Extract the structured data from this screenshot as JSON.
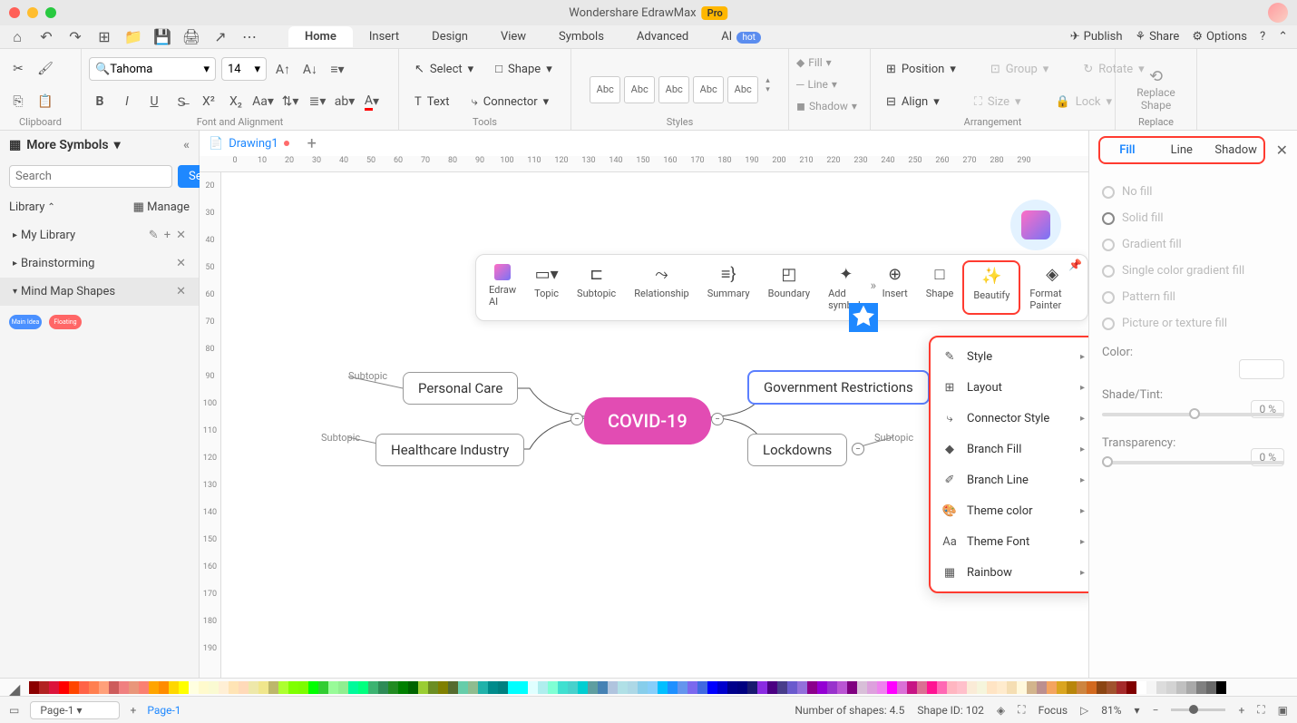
{
  "app": {
    "title": "Wondershare EdrawMax",
    "badge": "Pro"
  },
  "mainTabs": [
    "Home",
    "Insert",
    "Design",
    "View",
    "Symbols",
    "Advanced"
  ],
  "aiTab": {
    "label": "AI",
    "badge": "hot"
  },
  "topRight": {
    "publish": "Publish",
    "share": "Share",
    "options": "Options"
  },
  "ribbon": {
    "clipboard": "Clipboard",
    "font": "Font and Alignment",
    "tools": "Tools",
    "styles": "Styles",
    "arrangement": "Arrangement",
    "replace": "Replace",
    "fontName": "Tahoma",
    "fontSize": "14",
    "select": "Select",
    "shape": "Shape",
    "text": "Text",
    "connector": "Connector",
    "swatch": "Abc",
    "fill": "Fill",
    "line": "Line",
    "shadow": "Shadow",
    "position": "Position",
    "align": "Align",
    "group": "Group",
    "size": "Size",
    "rotate": "Rotate",
    "lock": "Lock",
    "replaceShape": "Replace\nShape"
  },
  "leftPanel": {
    "title": "More Symbols",
    "searchPlaceholder": "Search",
    "searchBtn": "Search",
    "library": "Library",
    "manage": "Manage",
    "items": [
      "My Library",
      "Brainstorming",
      "Mind Map Shapes"
    ]
  },
  "docTab": "Drawing1",
  "rulerH": [
    "0",
    "10",
    "20",
    "30",
    "40",
    "50",
    "60",
    "70",
    "80",
    "90",
    "100",
    "110",
    "120",
    "130",
    "140",
    "150",
    "160",
    "170",
    "180",
    "190",
    "200",
    "210",
    "220",
    "230",
    "240",
    "250",
    "260",
    "270",
    "280",
    "290"
  ],
  "rulerV": [
    "20",
    "30",
    "40",
    "50",
    "60",
    "70",
    "80",
    "90",
    "100",
    "110",
    "120",
    "130",
    "140",
    "150",
    "160",
    "170",
    "180",
    "190"
  ],
  "mindmap": {
    "central": "COVID-19",
    "nodes": [
      "Personal Care",
      "Healthcare Industry",
      "Government Restrictions",
      "Lockdowns"
    ],
    "subtopic": "Subtopic"
  },
  "floatToolbar": [
    "Edraw AI",
    "Topic",
    "Subtopic",
    "Relationship",
    "Summary",
    "Boundary",
    "Add symbol",
    "Insert",
    "Shape",
    "Beautify",
    "Format Painter"
  ],
  "ctxMenu": [
    "Style",
    "Layout",
    "Connector Style",
    "Branch Fill",
    "Branch Line",
    "Theme color",
    "Theme Font",
    "Rainbow"
  ],
  "rightPanel": {
    "tabs": [
      "Fill",
      "Line",
      "Shadow"
    ],
    "fillOptions": [
      "No fill",
      "Solid fill",
      "Gradient fill",
      "Single color gradient fill",
      "Pattern fill",
      "Picture or texture fill"
    ],
    "color": "Color:",
    "shadeTint": "Shade/Tint:",
    "transparency": "Transparency:",
    "pct": "0 %"
  },
  "status": {
    "page": "Page-1",
    "pageLabel": "Page-1",
    "shapes": "Number of shapes: 4.5",
    "shapeId": "Shape ID: 102",
    "focus": "Focus",
    "zoom": "81%"
  },
  "paletteColors": [
    "#8b0000",
    "#b22222",
    "#dc143c",
    "#ff0000",
    "#ff4500",
    "#ff6347",
    "#ff7f50",
    "#ffa07a",
    "#cd5c5c",
    "#f08080",
    "#e9967a",
    "#fa8072",
    "#ffa500",
    "#ff8c00",
    "#ffd700",
    "#ffff00",
    "#ffffe0",
    "#fffacd",
    "#fafad2",
    "#ffefd5",
    "#ffe4b5",
    "#ffdab9",
    "#eee8aa",
    "#f0e68c",
    "#bdb76b",
    "#adff2f",
    "#7fff00",
    "#7cfc00",
    "#00ff00",
    "#32cd32",
    "#98fb98",
    "#90ee90",
    "#00fa9a",
    "#00ff7f",
    "#3cb371",
    "#2e8b57",
    "#228b22",
    "#008000",
    "#006400",
    "#9acd32",
    "#6b8e23",
    "#808000",
    "#556b2f",
    "#66cdaa",
    "#8fbc8f",
    "#20b2aa",
    "#008b8b",
    "#008080",
    "#00ffff",
    "#00ffff",
    "#e0ffff",
    "#afeeee",
    "#7fffd4",
    "#40e0d0",
    "#48d1cc",
    "#00ced1",
    "#5f9ea0",
    "#4682b4",
    "#b0c4de",
    "#b0e0e6",
    "#add8e6",
    "#87ceeb",
    "#87cefa",
    "#00bfff",
    "#1e90ff",
    "#6495ed",
    "#7b68ee",
    "#4169e1",
    "#0000ff",
    "#0000cd",
    "#00008b",
    "#000080",
    "#191970",
    "#8a2be2",
    "#4b0082",
    "#483d8b",
    "#6a5acd",
    "#9370db",
    "#8b008b",
    "#9400d3",
    "#9932cc",
    "#ba55d3",
    "#800080",
    "#d8bfd8",
    "#dda0dd",
    "#ee82ee",
    "#ff00ff",
    "#da70d6",
    "#c71585",
    "#db7093",
    "#ff1493",
    "#ff69b4",
    "#ffb6c1",
    "#ffc0cb",
    "#faebd7",
    "#f5f5dc",
    "#ffe4c4",
    "#ffebcd",
    "#f5deb3",
    "#fff8dc",
    "#d2b48c",
    "#bc8f8f",
    "#f4a460",
    "#daa520",
    "#b8860b",
    "#cd853f",
    "#d2691e",
    "#8b4513",
    "#a0522d",
    "#a52a2a",
    "#800000",
    "#ffffff",
    "#f5f5f5",
    "#dcdcdc",
    "#d3d3d3",
    "#c0c0c0",
    "#a9a9a9",
    "#808080",
    "#696969",
    "#000000"
  ]
}
